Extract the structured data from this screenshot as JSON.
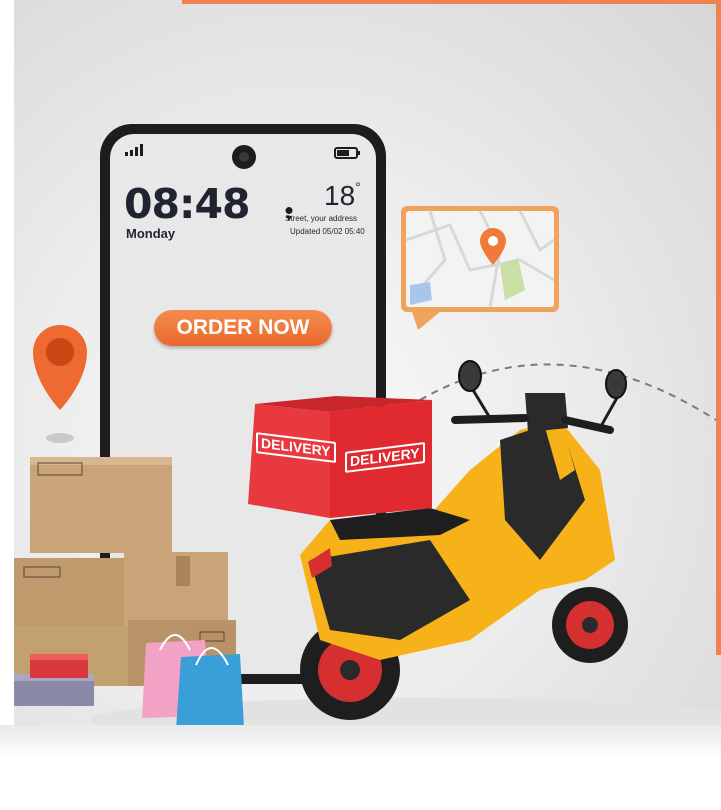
{
  "phone": {
    "time": "08:48",
    "day": "Monday",
    "temperature": "18",
    "temperature_unit": "°",
    "address": "Street, your address",
    "updated": "Updated 05/02 05:40"
  },
  "cta": {
    "label": "ORDER NOW"
  },
  "box": {
    "label_left": "DELIVERY",
    "label_right": "DELIVERY"
  },
  "colors": {
    "accent": "#f0824f",
    "scooter_yellow": "#f7b21a",
    "delivery_red": "#e8333a",
    "box_brown": "#c9a478"
  }
}
